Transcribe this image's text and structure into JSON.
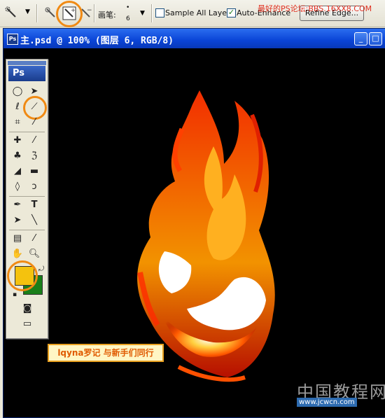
{
  "options_bar": {
    "brush_label": "画笔:",
    "brush_size": "6",
    "sample_all_layers": "Sample All Layers",
    "auto_enhance": "Auto-Enhance",
    "refine_edge": "Refine Edge...",
    "watermark": "最好的PS论坛:BBS.16XX8.COM"
  },
  "document": {
    "title": "主.psd @ 100% (图层 6, RGB/8)",
    "ps_icon": "Ps"
  },
  "toolbox": {
    "logo": "Ps",
    "text_tool": "T",
    "foreground_color": "#f4c20e",
    "background_color": "#1a7f1a"
  },
  "banner": {
    "text": "lqyna罗记 与新手们同行"
  },
  "footer": {
    "site_name": "中国教程网",
    "site_url": "www.jcwcn.com"
  },
  "colors": {
    "highlight_circle": "#f08a14",
    "titlebar": "#0a44d6"
  }
}
